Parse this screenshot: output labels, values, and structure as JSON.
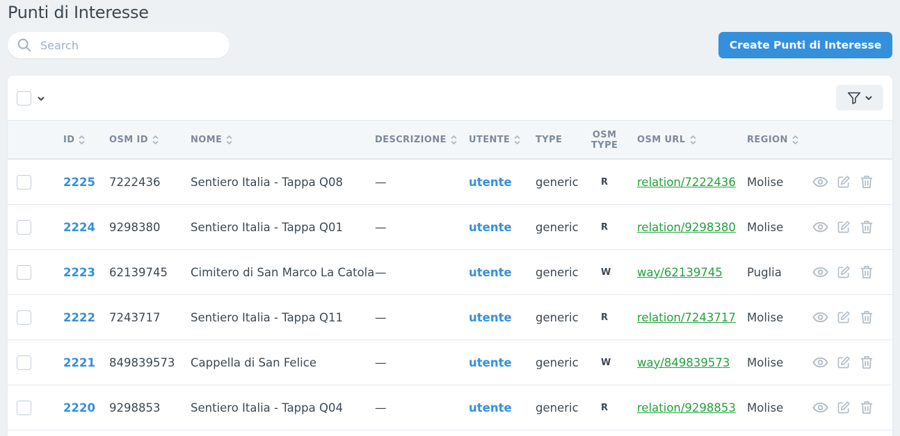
{
  "page": {
    "title": "Punti di Interesse"
  },
  "search": {
    "placeholder": "Search",
    "value": ""
  },
  "create_button": {
    "label": "Create Punti di Interesse"
  },
  "colors": {
    "primary": "#3490dc",
    "link_green": "#21a33a",
    "background": "#eef1f4"
  },
  "table": {
    "columns": {
      "id": "ID",
      "osm_id": "OSM ID",
      "nome": "NOME",
      "descrizione": "DESCRIZIONE",
      "utente": "UTENTE",
      "type": "TYPE",
      "osm_type_line1": "OSM",
      "osm_type_line2": "TYPE",
      "osm_url": "OSM URL",
      "region": "REGION"
    },
    "rows": [
      {
        "id": "2225",
        "osm_id": "7222436",
        "nome": "Sentiero Italia - Tappa Q08",
        "descrizione": "—",
        "utente": "utente",
        "type": "generic",
        "osm_type": "R",
        "osm_url": "relation/7222436",
        "region": "Molise"
      },
      {
        "id": "2224",
        "osm_id": "9298380",
        "nome": "Sentiero Italia - Tappa Q01",
        "descrizione": "—",
        "utente": "utente",
        "type": "generic",
        "osm_type": "R",
        "osm_url": "relation/9298380",
        "region": "Molise"
      },
      {
        "id": "2223",
        "osm_id": "62139745",
        "nome": "Cimitero di San Marco La Catola",
        "descrizione": "—",
        "utente": "utente",
        "type": "generic",
        "osm_type": "W",
        "osm_url": "way/62139745",
        "region": "Puglia"
      },
      {
        "id": "2222",
        "osm_id": "7243717",
        "nome": "Sentiero Italia - Tappa Q11",
        "descrizione": "—",
        "utente": "utente",
        "type": "generic",
        "osm_type": "R",
        "osm_url": "relation/7243717",
        "region": "Molise"
      },
      {
        "id": "2221",
        "osm_id": "849839573",
        "nome": "Cappella di San Felice",
        "descrizione": "—",
        "utente": "utente",
        "type": "generic",
        "osm_type": "W",
        "osm_url": "way/849839573",
        "region": "Molise"
      },
      {
        "id": "2220",
        "osm_id": "9298853",
        "nome": "Sentiero Italia - Tappa Q04",
        "descrizione": "—",
        "utente": "utente",
        "type": "generic",
        "osm_type": "R",
        "osm_url": "relation/9298853",
        "region": "Molise"
      }
    ],
    "row_icons": [
      "eye-icon",
      "edit-icon",
      "trash-icon"
    ]
  }
}
